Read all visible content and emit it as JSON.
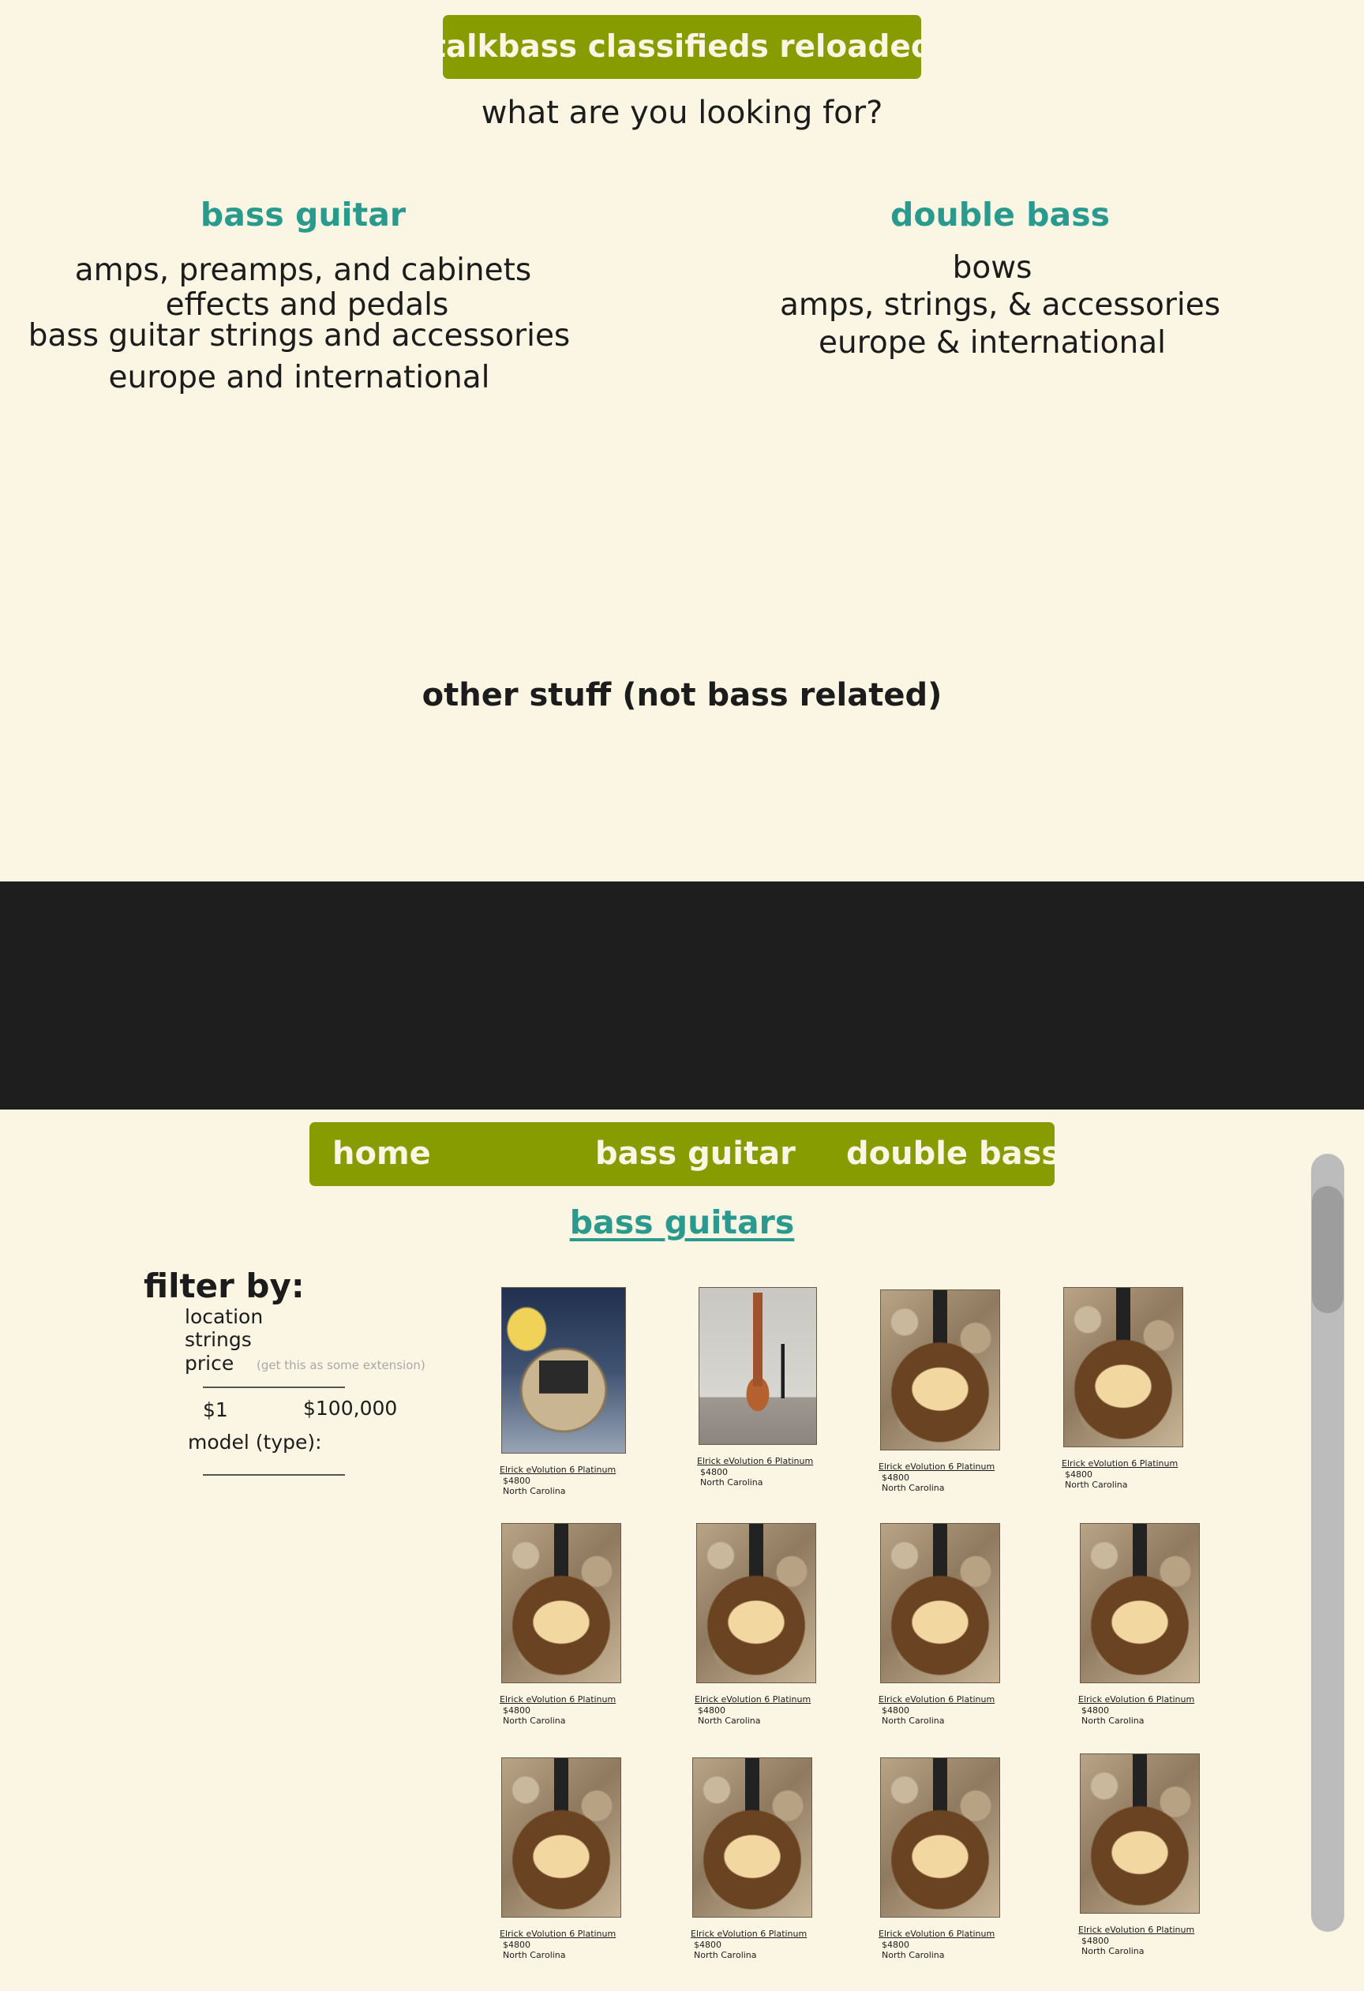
{
  "header": {
    "brand": "talkbass classifieds reloaded",
    "question": "what are you looking for?"
  },
  "categories": {
    "bass_guitar": {
      "title": "bass guitar",
      "links": [
        "amps, preamps, and cabinets",
        "effects and pedals",
        "bass guitar strings and accessories",
        "europe and international"
      ]
    },
    "double_bass": {
      "title": "double bass",
      "links": [
        "bows",
        "amps, strings, & accessories",
        "europe & international"
      ]
    },
    "other": "other stuff (not bass related)"
  },
  "nav": {
    "home": "home",
    "bass_guitar": "bass guitar",
    "double_bass": "double bass"
  },
  "listing": {
    "title": "bass guitars",
    "filter": {
      "title": "filter by:",
      "location": "location",
      "strings": "strings",
      "price": "price",
      "price_hint": "(get this as some extension)",
      "price_min": "$1",
      "price_max": "$100,000",
      "model": "model (type):"
    },
    "items": [
      {
        "title": "Elrick eVolution 6 Platinum",
        "price": "$4800",
        "location": "North Carolina",
        "photo": "first"
      },
      {
        "title": "Elrick eVolution 6 Platinum",
        "price": "$4800",
        "location": "North Carolina",
        "photo": "room"
      },
      {
        "title": "Elrick eVolution 6 Platinum",
        "price": "$4800",
        "location": "North Carolina",
        "photo": "wood"
      },
      {
        "title": "Elrick eVolution 6 Platinum",
        "price": "$4800",
        "location": "North Carolina",
        "photo": "wood"
      },
      {
        "title": "Elrick eVolution 6 Platinum",
        "price": "$4800",
        "location": "North Carolina",
        "photo": "wood"
      },
      {
        "title": "Elrick eVolution 6 Platinum",
        "price": "$4800",
        "location": "North Carolina",
        "photo": "wood"
      },
      {
        "title": "Elrick eVolution 6 Platinum",
        "price": "$4800",
        "location": "North Carolina",
        "photo": "wood"
      },
      {
        "title": "Elrick eVolution 6 Platinum",
        "price": "$4800",
        "location": "North Carolina",
        "photo": "wood"
      },
      {
        "title": "Elrick eVolution 6 Platinum",
        "price": "$4800",
        "location": "North Carolina",
        "photo": "wood"
      },
      {
        "title": "Elrick eVolution 6 Platinum",
        "price": "$4800",
        "location": "North Carolina",
        "photo": "wood"
      },
      {
        "title": "Elrick eVolution 6 Platinum",
        "price": "$4800",
        "location": "North Carolina",
        "photo": "wood"
      },
      {
        "title": "Elrick eVolution 6 Platinum",
        "price": "$4800",
        "location": "North Carolina",
        "photo": "wood"
      }
    ]
  },
  "colors": {
    "background": "#fbf5e3",
    "accent": "#869c00",
    "link_teal": "#2a9a8e",
    "dark_band": "#1e1e1e"
  }
}
